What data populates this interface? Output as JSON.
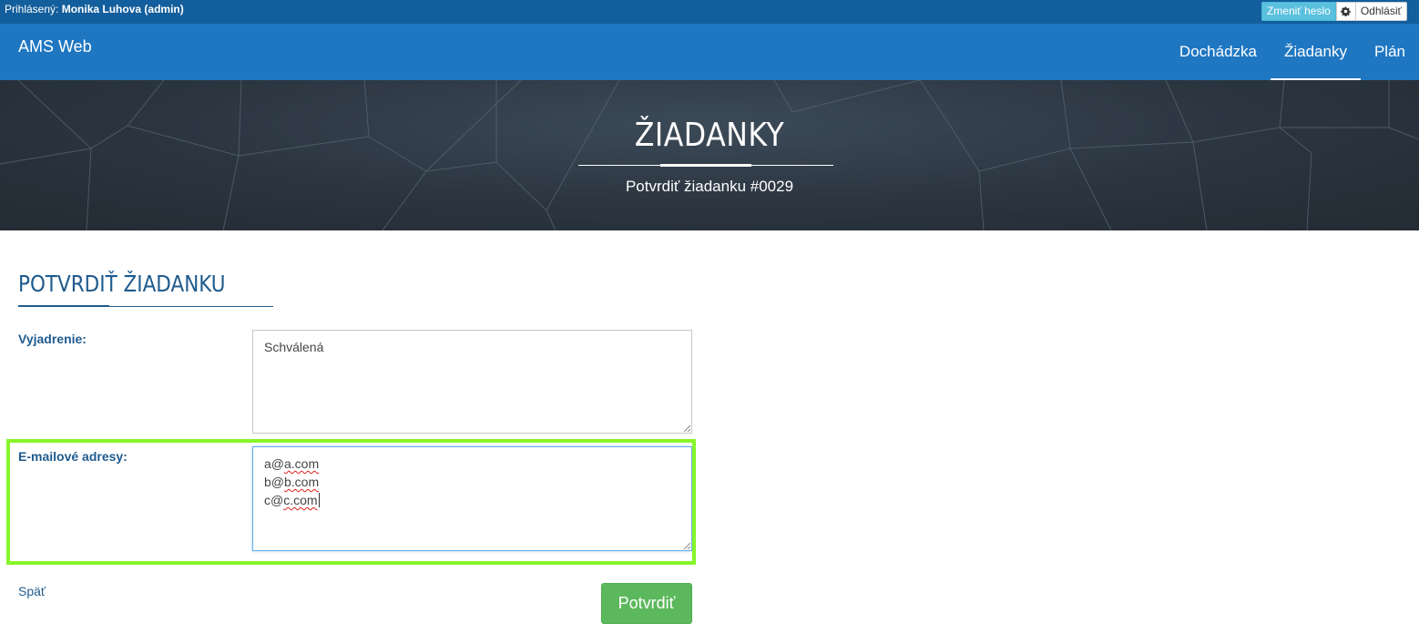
{
  "topbar": {
    "logged_label": "Prihlásený:",
    "user": "Monika Luhova (admin)",
    "change_password": "Zmeniť heslo",
    "settings_icon": "gear-icon",
    "logout": "Odhlásiť"
  },
  "navbar": {
    "brand": "AMS Web",
    "items": [
      {
        "label": "Dochádzka",
        "active": false
      },
      {
        "label": "Žiadanky",
        "active": true
      },
      {
        "label": "Plán",
        "active": false
      }
    ]
  },
  "hero": {
    "title": "ŽIADANKY",
    "subtitle": "Potvrdiť žiadanku #0029"
  },
  "form": {
    "title": "POTVRDIŤ ŽIADANKU",
    "statement_label": "Vyjadrenie:",
    "statement_value": "Schválená",
    "emails_label": "E-mailové adresy:",
    "emails": [
      {
        "user": "a@",
        "domain": "a.com"
      },
      {
        "user": "b@",
        "domain": "b.com"
      },
      {
        "user": "c@",
        "domain": "c.com"
      }
    ],
    "back_link": "Späť",
    "confirm_button": "Potvrdiť"
  },
  "colors": {
    "topbar": "#135e9c",
    "navbar": "#1f77c2",
    "accent_text": "#1f5b8e",
    "info_button": "#5bc0de",
    "success_button": "#5cb85c",
    "highlight": "#86f52a"
  }
}
